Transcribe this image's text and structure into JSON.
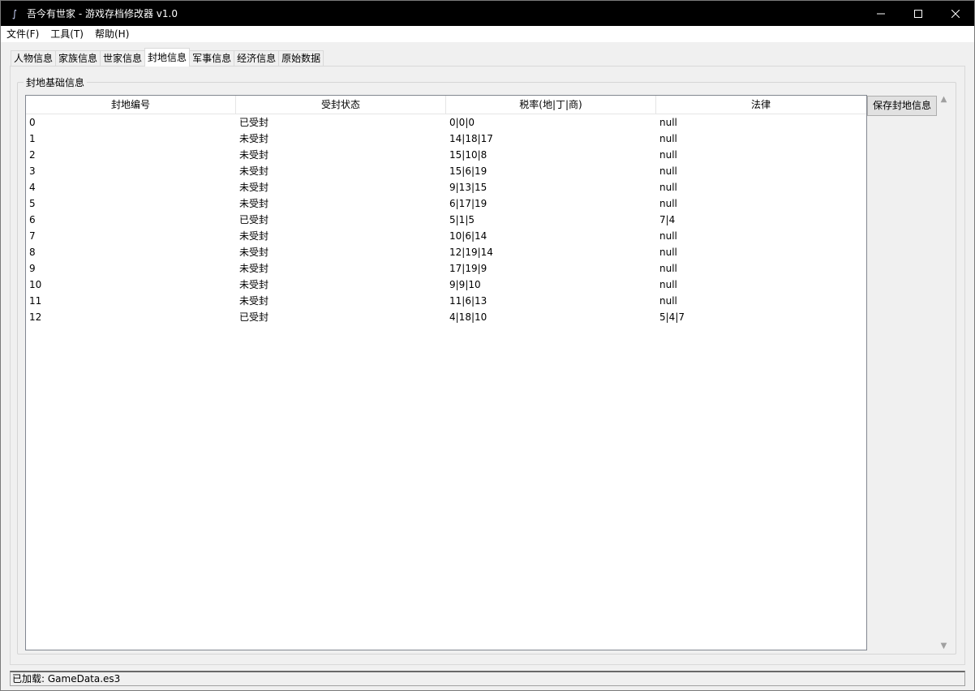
{
  "window": {
    "title": "吾今有世家 - 游戏存档修改器 v1.0",
    "controls": {
      "minimize": "─",
      "maximize": "☐",
      "close": "✕"
    }
  },
  "menu": [
    "文件(F)",
    "工具(T)",
    "帮助(H)"
  ],
  "tabs": [
    "人物信息",
    "家族信息",
    "世家信息",
    "封地信息",
    "军事信息",
    "经济信息",
    "原始数据"
  ],
  "active_tab": "封地信息",
  "group_title": "封地基础信息",
  "table": {
    "columns": [
      "封地编号",
      "受封状态",
      "税率(地|丁|商)",
      "法律"
    ],
    "rows": [
      [
        "0",
        "已受封",
        "0|0|0",
        "null"
      ],
      [
        "1",
        "未受封",
        "14|18|17",
        "null"
      ],
      [
        "2",
        "未受封",
        "15|10|8",
        "null"
      ],
      [
        "3",
        "未受封",
        "15|6|19",
        "null"
      ],
      [
        "4",
        "未受封",
        "9|13|15",
        "null"
      ],
      [
        "5",
        "未受封",
        "6|17|19",
        "null"
      ],
      [
        "6",
        "已受封",
        "5|1|5",
        "7|4"
      ],
      [
        "7",
        "未受封",
        "10|6|14",
        "null"
      ],
      [
        "8",
        "未受封",
        "12|19|14",
        "null"
      ],
      [
        "9",
        "未受封",
        "17|19|9",
        "null"
      ],
      [
        "10",
        "未受封",
        "9|9|10",
        "null"
      ],
      [
        "11",
        "未受封",
        "11|6|13",
        "null"
      ],
      [
        "12",
        "已受封",
        "4|18|10",
        "5|4|7"
      ]
    ]
  },
  "save_button": "保存封地信息",
  "status": "已加载: GameData.es3"
}
